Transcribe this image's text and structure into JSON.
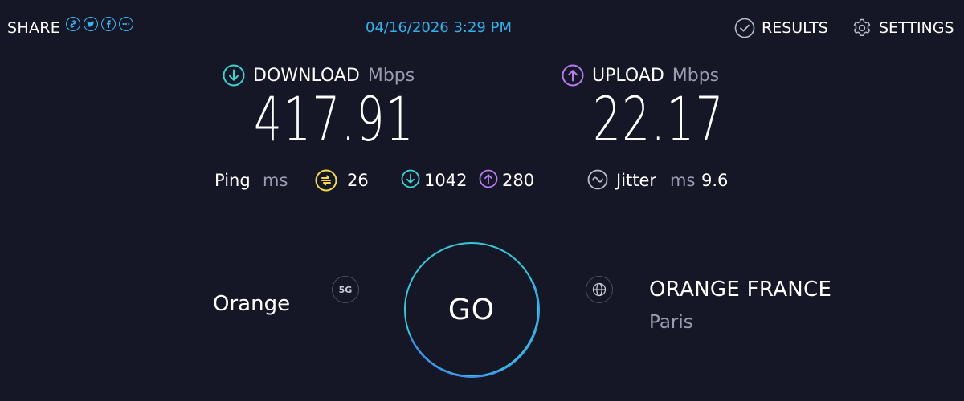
{
  "header": {
    "share_label": "SHARE",
    "share_icons": [
      "link-icon",
      "twitter-icon",
      "facebook-icon",
      "more-icon"
    ],
    "datetime": "04/16/2026 3:29 PM",
    "results_label": "RESULTS",
    "settings_label": "SETTINGS"
  },
  "download": {
    "label": "DOWNLOAD",
    "unit": "Mbps",
    "value": "417.91",
    "icon_color": "#3ed2d1"
  },
  "upload": {
    "label": "UPLOAD",
    "unit": "Mbps",
    "value": "22.17",
    "icon_color": "#b77cf2"
  },
  "ping": {
    "label": "Ping",
    "unit": "ms",
    "idle": "26",
    "download": "1042",
    "upload": "280",
    "idle_icon_color": "#f5d94e"
  },
  "jitter": {
    "label": "Jitter",
    "unit": "ms",
    "value": "9.6"
  },
  "provider": {
    "name": "Orange",
    "network_badge": "5G"
  },
  "go": {
    "label": "GO",
    "ring_color": "#3ac5d8"
  },
  "server": {
    "name": "ORANGE FRANCE",
    "location": "Paris"
  },
  "colors": {
    "background": "#151626",
    "accent": "#35b0ea",
    "muted": "#9a9db0"
  }
}
